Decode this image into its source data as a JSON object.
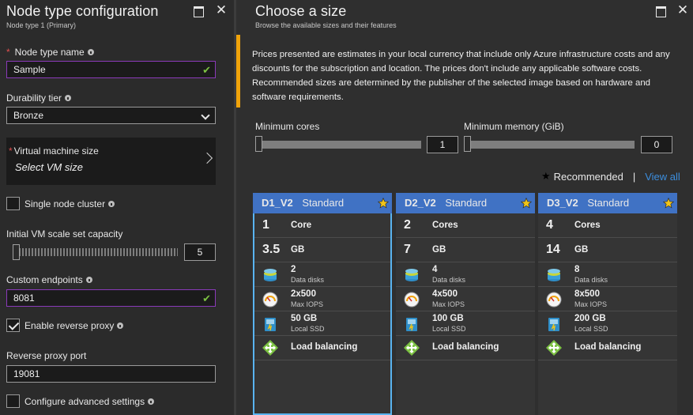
{
  "left": {
    "title": "Node type configuration",
    "subtitle": "Node type 1 (Primary)",
    "node_type_name": {
      "label": "Node type name",
      "value": "Sample"
    },
    "durability": {
      "label": "Durability tier",
      "value": "Bronze"
    },
    "vm_size": {
      "label": "Virtual machine size",
      "value": "Select VM size"
    },
    "single_node": {
      "label": "Single node cluster",
      "checked": false
    },
    "capacity": {
      "label": "Initial VM scale set capacity",
      "value": "5"
    },
    "endpoints": {
      "label": "Custom endpoints",
      "value": "8081"
    },
    "reverse_proxy": {
      "label": "Enable reverse proxy",
      "checked": true
    },
    "proxy_port": {
      "label": "Reverse proxy port",
      "value": "19081"
    },
    "advanced": {
      "label": "Configure advanced settings",
      "checked": false
    }
  },
  "right": {
    "title": "Choose a size",
    "subtitle": "Browse the available sizes and their features",
    "notice": "Prices presented are estimates in your local currency that include only Azure infrastructure costs and any discounts for the subscription and location. The prices don't include any applicable software costs. Recommended sizes are determined by the publisher of the selected image based on hardware and software requirements.",
    "min_cores": {
      "label": "Minimum cores",
      "value": "1"
    },
    "min_memory": {
      "label": "Minimum memory (GiB)",
      "value": "0"
    },
    "recommended_label": "Recommended",
    "separator": "|",
    "view_all": "View all",
    "labels": {
      "core": "Core",
      "cores": "Cores",
      "gb": "GB",
      "data_disks": "Data disks",
      "max_iops": "Max IOPS",
      "local_ssd": "Local SSD",
      "load_balancing": "Load balancing"
    },
    "cards": [
      {
        "name": "D1_V2",
        "tier": "Standard",
        "cores": "1",
        "cores_unit": "Core",
        "memory": "3.5",
        "disks": "2",
        "iops": "2x500",
        "ssd": "50 GB"
      },
      {
        "name": "D2_V2",
        "tier": "Standard",
        "cores": "2",
        "cores_unit": "Cores",
        "memory": "7",
        "disks": "4",
        "iops": "4x500",
        "ssd": "100 GB"
      },
      {
        "name": "D3_V2",
        "tier": "Standard",
        "cores": "4",
        "cores_unit": "Cores",
        "memory": "14",
        "disks": "8",
        "iops": "8x500",
        "ssd": "200 GB"
      }
    ]
  },
  "colors": {
    "accent": "#4072c4",
    "selected_border": "#59b4f0",
    "warning_bar": "#f0a30a",
    "valid": "#7cc242",
    "link": "#3c8ede"
  }
}
